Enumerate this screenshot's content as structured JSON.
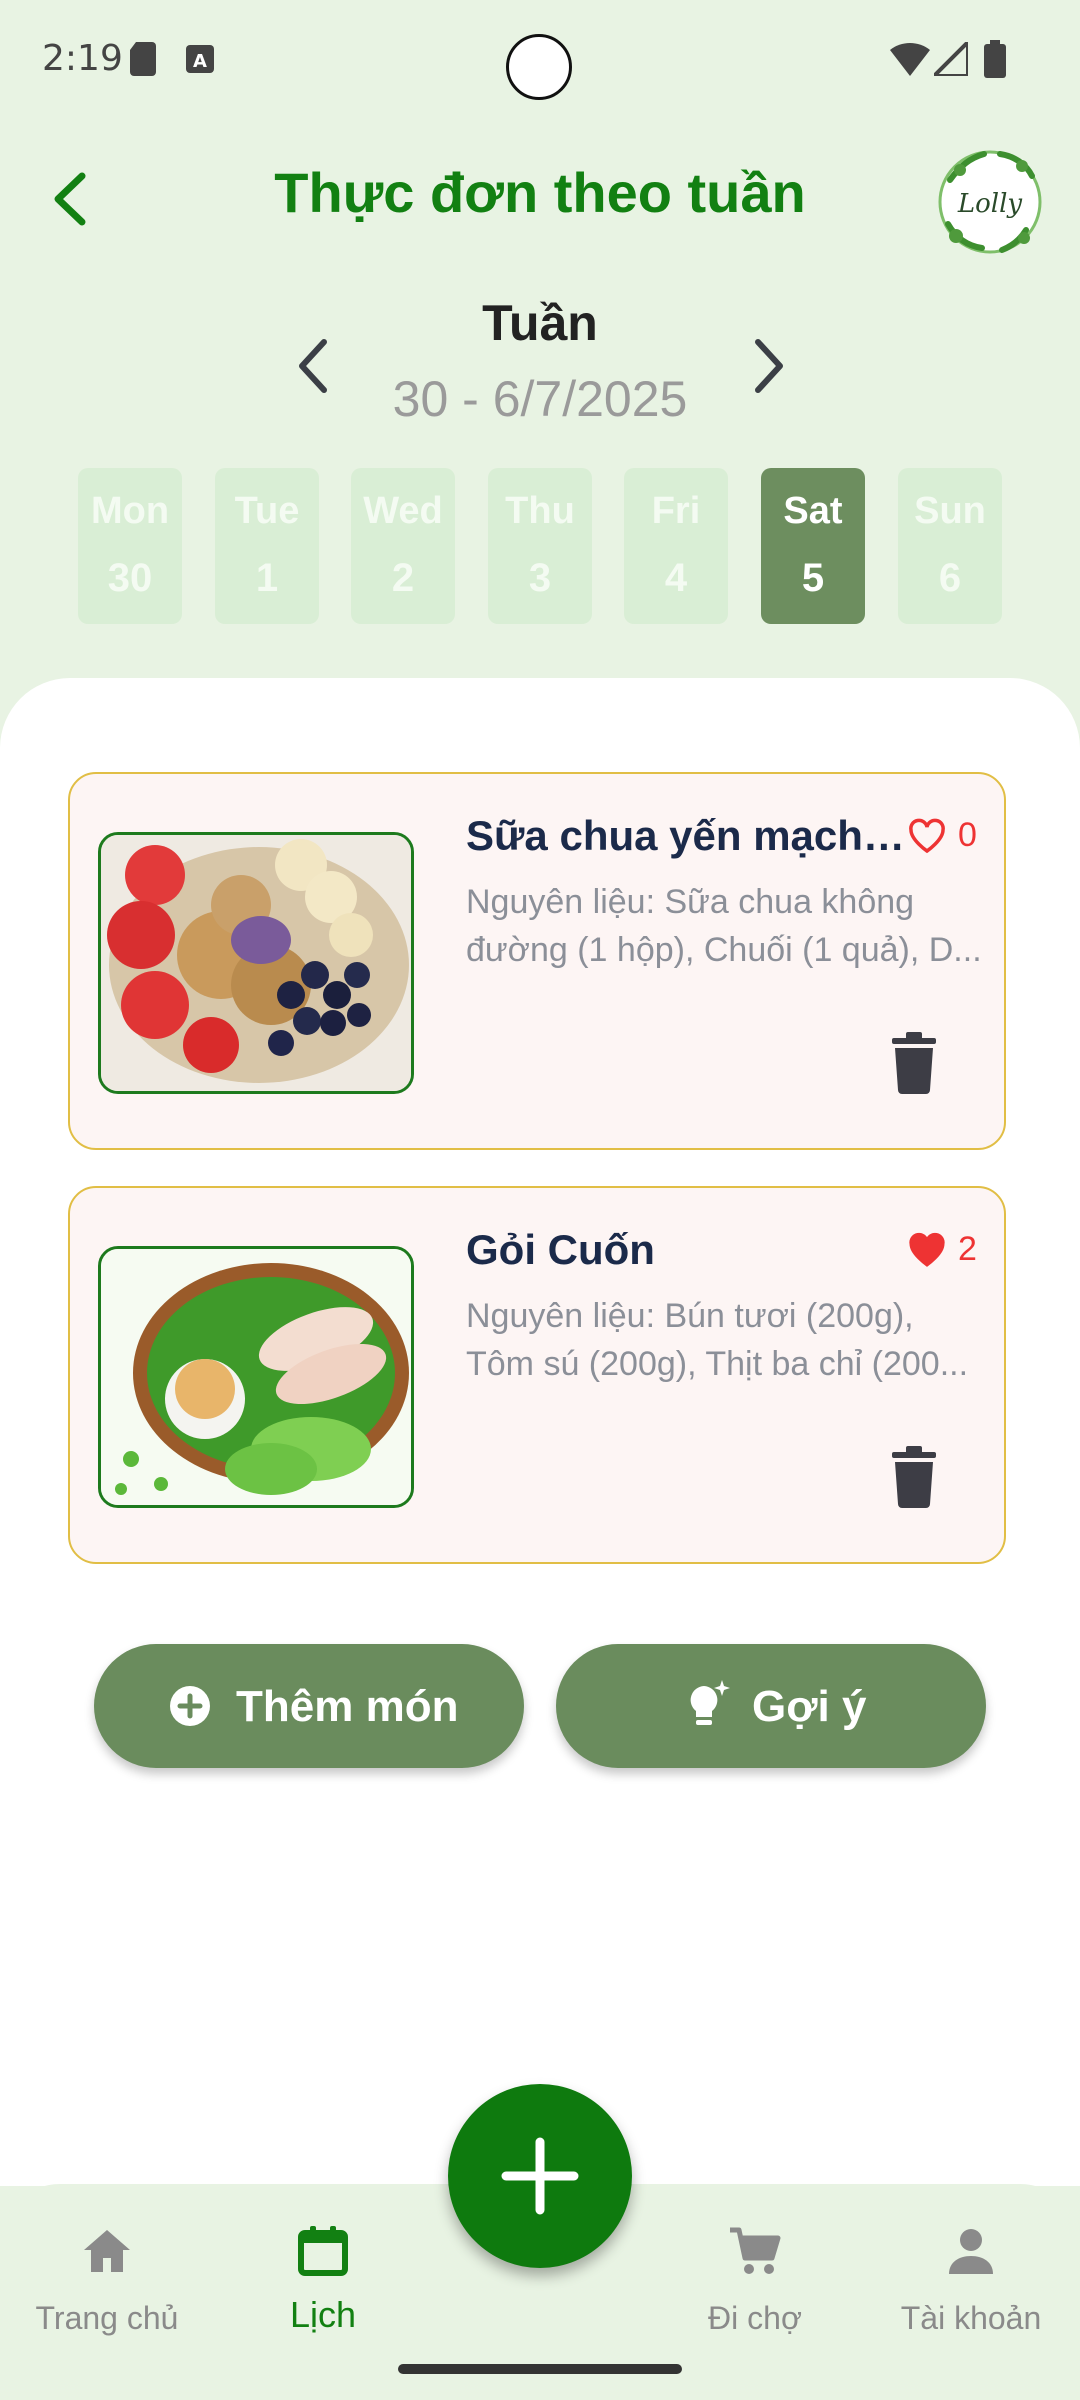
{
  "status_bar": {
    "time": "2:19"
  },
  "header": {
    "title": "Thực đơn theo tuần",
    "logo_text": "Lolly"
  },
  "week": {
    "label": "Tuần",
    "range": "30 - 6/7/2025",
    "days": [
      {
        "name": "Mon",
        "num": "30",
        "active": false
      },
      {
        "name": "Tue",
        "num": "1",
        "active": false
      },
      {
        "name": "Wed",
        "num": "2",
        "active": false
      },
      {
        "name": "Thu",
        "num": "3",
        "active": false
      },
      {
        "name": "Fri",
        "num": "4",
        "active": false
      },
      {
        "name": "Sat",
        "num": "5",
        "active": true
      },
      {
        "name": "Sun",
        "num": "6",
        "active": false
      }
    ]
  },
  "meals": [
    {
      "title": "Sữa chua yến mạch t...",
      "likes": "0",
      "liked": false,
      "desc_line1": "Nguyên liệu: Sữa chua không",
      "desc_line2": "đường (1 hộp), Chuối (1 quả), D..."
    },
    {
      "title": "Gỏi Cuốn",
      "likes": "2",
      "liked": true,
      "desc_line1": "Nguyên liệu: Bún tươi (200g),",
      "desc_line2": "Tôm sú (200g), Thịt ba chỉ (200..."
    }
  ],
  "actions": {
    "add_label": "Thêm món",
    "suggest_label": "Gợi ý"
  },
  "nav": {
    "home": "Trang chủ",
    "calendar": "Lịch",
    "market": "Đi chợ",
    "account": "Tài khoản"
  },
  "colors": {
    "primary": "#128012",
    "accent_button": "#6a8c5d",
    "background": "#e8f3e3",
    "card_border": "#e1be45",
    "like": "#e33"
  }
}
